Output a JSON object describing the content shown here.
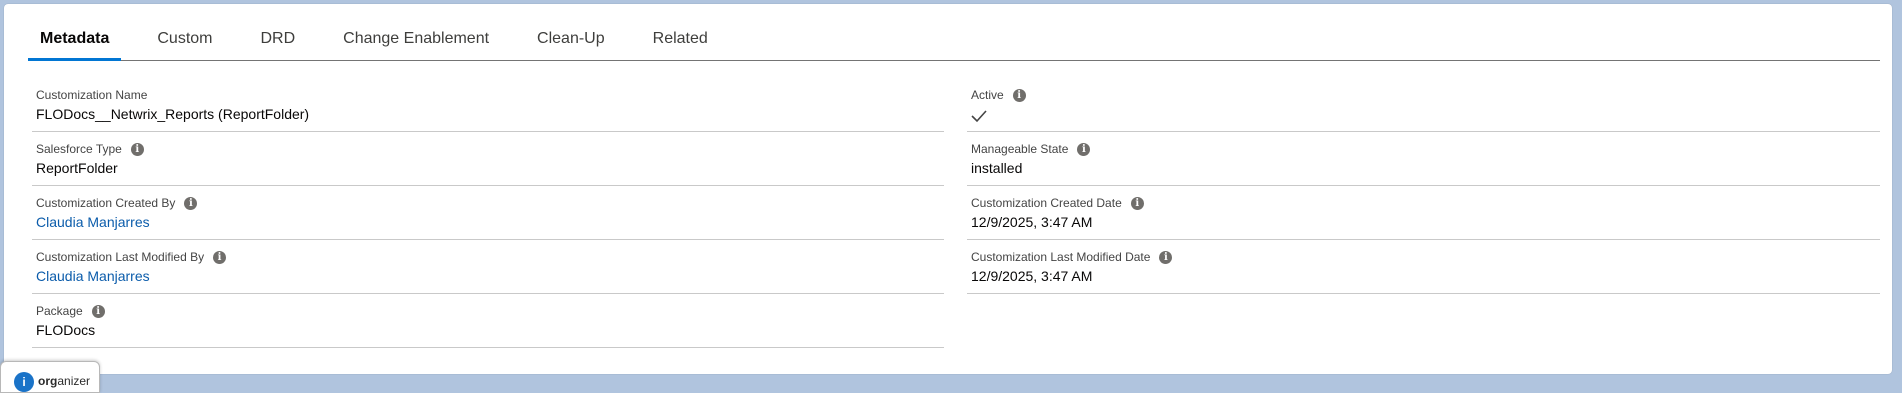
{
  "tabs": [
    {
      "label": "Metadata",
      "active": true
    },
    {
      "label": "Custom",
      "active": false
    },
    {
      "label": "DRD",
      "active": false
    },
    {
      "label": "Change Enablement",
      "active": false
    },
    {
      "label": "Clean-Up",
      "active": false
    },
    {
      "label": "Related",
      "active": false
    }
  ],
  "fields": {
    "customization_name": {
      "label": "Customization Name",
      "value": "FLODocs__Netwrix_Reports (ReportFolder)"
    },
    "active": {
      "label": "Active",
      "checked": true,
      "icon": "check-icon"
    },
    "salesforce_type": {
      "label": "Salesforce Type",
      "value": "ReportFolder"
    },
    "manageable_state": {
      "label": "Manageable State",
      "value": "installed"
    },
    "created_by": {
      "label": "Customization Created By",
      "value": "Claudia Manjarres"
    },
    "created_date": {
      "label": "Customization Created Date",
      "value": "12/9/2025, 3:47 AM"
    },
    "modified_by": {
      "label": "Customization Last Modified By",
      "value": "Claudia Manjarres"
    },
    "modified_date": {
      "label": "Customization Last Modified Date",
      "value": "12/9/2025, 3:47 AM"
    },
    "package": {
      "label": "Package",
      "value": "FLODocs"
    }
  },
  "organizer": {
    "prefix": "org",
    "suffix": "anizer",
    "icon": "organizer-logo-icon"
  },
  "colors": {
    "accent": "#0176d3",
    "link": "#0b5cab",
    "background": "#b0c4de"
  }
}
